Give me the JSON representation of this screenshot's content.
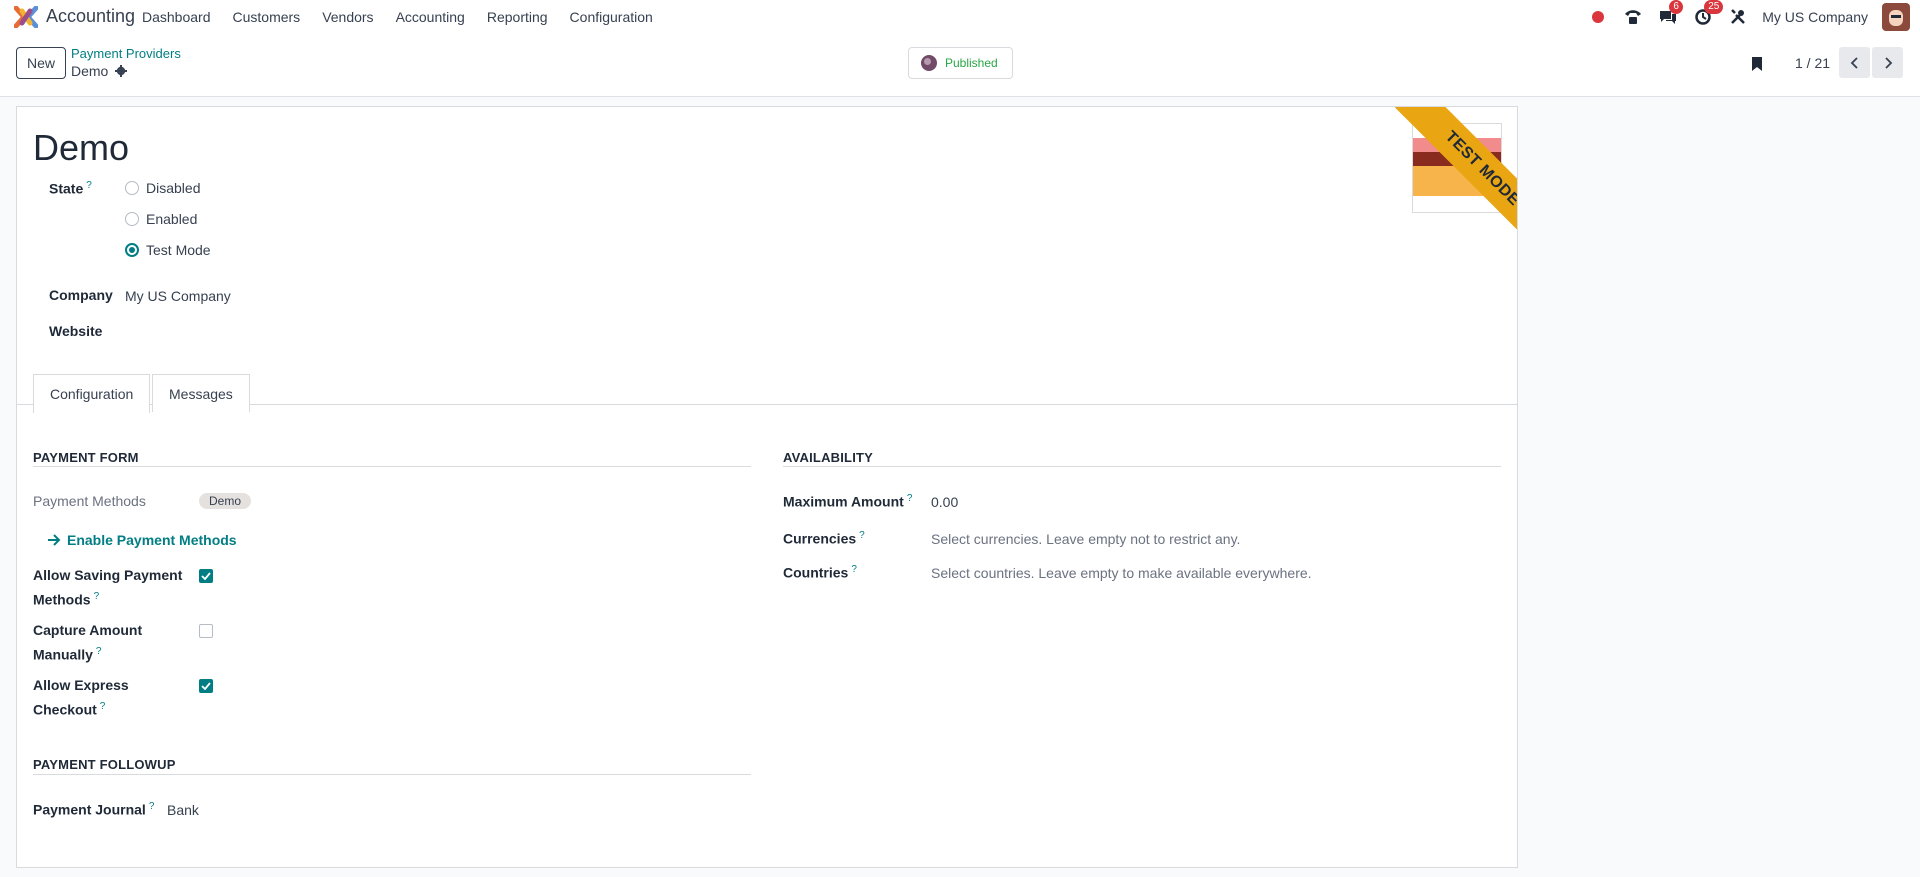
{
  "navbar": {
    "app_name": "Accounting",
    "menu": [
      "Dashboard",
      "Customers",
      "Vendors",
      "Accounting",
      "Reporting",
      "Configuration"
    ],
    "messages_count": "6",
    "activities_count": "25",
    "company": "My US Company"
  },
  "control_panel": {
    "new_label": "New",
    "breadcrumb_parent": "Payment Providers",
    "breadcrumb_current": "Demo",
    "published_label": "Published",
    "pager": "1 / 21"
  },
  "form": {
    "title": "Demo",
    "ribbon": "TEST MODE",
    "state_label": "State",
    "state_options": [
      "Disabled",
      "Enabled",
      "Test Mode"
    ],
    "state_selected": "Test Mode",
    "company_label": "Company",
    "company_value": "My US Company",
    "website_label": "Website",
    "tabs": [
      "Configuration",
      "Messages"
    ],
    "payment_form": {
      "title": "PAYMENT FORM",
      "payment_methods_label": "Payment Methods",
      "payment_methods_tag": "Demo",
      "enable_link": "Enable Payment Methods",
      "allow_saving_label": "Allow Saving Payment Methods",
      "allow_saving": true,
      "capture_manually_label": "Capture Amount Manually",
      "capture_manually": false,
      "express_checkout_label": "Allow Express Checkout",
      "express_checkout": true
    },
    "availability": {
      "title": "AVAILABILITY",
      "max_amount_label": "Maximum Amount",
      "max_amount_value": "0.00",
      "currencies_label": "Currencies",
      "currencies_placeholder": "Select currencies. Leave empty not to restrict any.",
      "countries_label": "Countries",
      "countries_placeholder": "Select countries. Leave empty to make available everywhere."
    },
    "followup": {
      "title": "PAYMENT FOLLOWUP",
      "journal_label": "Payment Journal",
      "journal_value": "Bank"
    }
  },
  "colors": {
    "accent": "#017e84",
    "ribbon": "#e9a512",
    "badge": "#d9363e",
    "brand": "#714b67"
  }
}
